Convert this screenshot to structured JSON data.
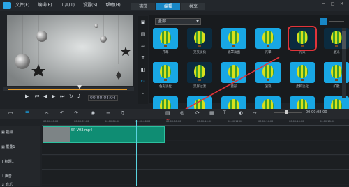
{
  "menu": [
    "文件(F)",
    "编辑(E)",
    "工具(T)",
    "设置(S)",
    "帮助(H)"
  ],
  "tabs": [
    "捕获",
    "编辑",
    "共享"
  ],
  "window_controls": [
    "−",
    "□",
    "✕"
  ],
  "filter_dropdown": "全部",
  "preview_timecode": "00:00:04:04",
  "timeline_timecode": "00:00:08:00",
  "colors": {
    "accent": "#1887c6",
    "clip": "#0f8d73",
    "selection": "#e0343b",
    "playhead": "#5ad3e0"
  },
  "effects": [
    {
      "label": "开幕",
      "dark": false
    },
    {
      "label": "交叉淡化",
      "dark": true
    },
    {
      "label": "遮罩淡出",
      "dark": false
    },
    {
      "label": "光晕",
      "dark": false
    },
    {
      "label": "光束",
      "dark": true,
      "selected": true
    },
    {
      "label": "星光",
      "dark": true
    },
    {
      "label": "色彩淡化",
      "dark": false
    },
    {
      "label": "黑屏过渡",
      "dark": true
    },
    {
      "label": "菱形",
      "dark": false
    },
    {
      "label": "波浪",
      "dark": false
    },
    {
      "label": "柔和淡化",
      "dark": false
    },
    {
      "label": "扩散",
      "dark": false
    },
    {
      "label": "",
      "dark": false
    },
    {
      "label": "",
      "dark": false
    },
    {
      "label": "",
      "dark": false
    },
    {
      "label": "",
      "dark": false
    },
    {
      "label": "",
      "dark": false
    },
    {
      "label": "",
      "dark": false
    }
  ],
  "tracks": [
    {
      "label": "视频",
      "icon": "video-track-icon"
    },
    {
      "label": "覆叠1",
      "icon": "overlay-track-icon"
    },
    {
      "label": "标题1",
      "icon": "title-track-icon"
    },
    {
      "label": "声音",
      "icon": "voice-track-icon"
    },
    {
      "label": "音乐",
      "icon": "music-track-icon"
    }
  ],
  "clip": {
    "name": "SP-V03.mp4"
  },
  "ruler_ticks": [
    "00:00:00:00",
    "00:00:02:00",
    "00:00:04:00",
    "00:00:06:00",
    "00:00:08:00",
    "00:00:10:00",
    "00:00:12:00",
    "00:00:14:00",
    "00:00:16:00",
    "00:00:18:00"
  ]
}
